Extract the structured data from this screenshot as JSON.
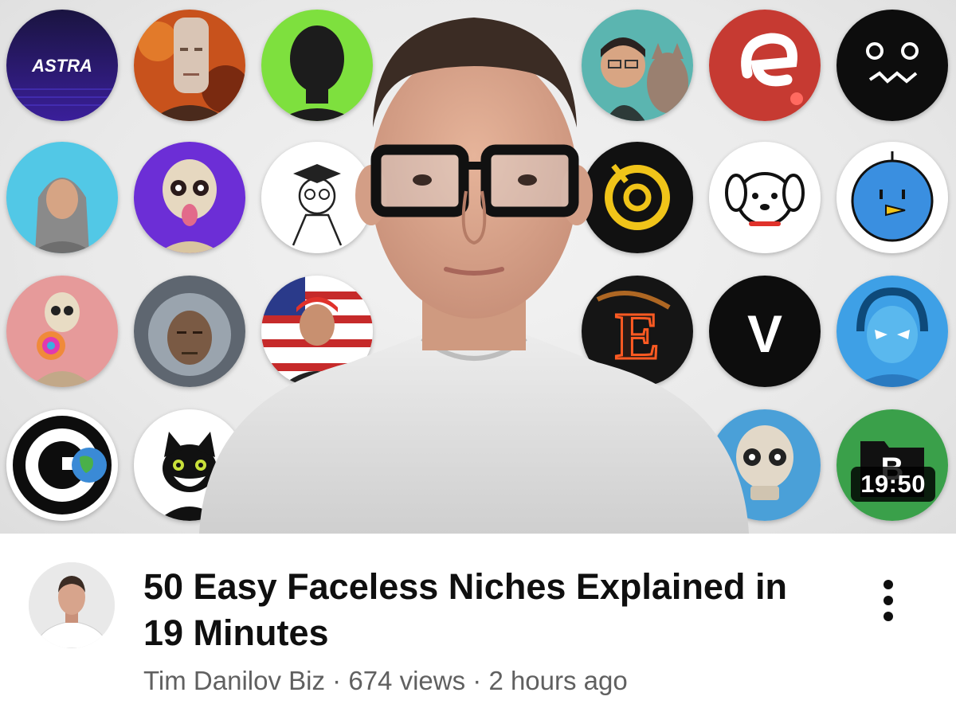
{
  "video": {
    "title": "50 Easy Faceless Niches Explained in 19 Minutes",
    "duration": "19:50",
    "channel": "Tim Danilov Biz",
    "views": "674 views",
    "age": "2 hours ago",
    "separator": "·"
  },
  "thumbnail_badges": {
    "astra_logo": "ASTRA",
    "letter_e": "E",
    "letter_v": "V",
    "letter_b": "B",
    "letter_g": "G"
  },
  "icons": [
    "more-vert-icon"
  ]
}
